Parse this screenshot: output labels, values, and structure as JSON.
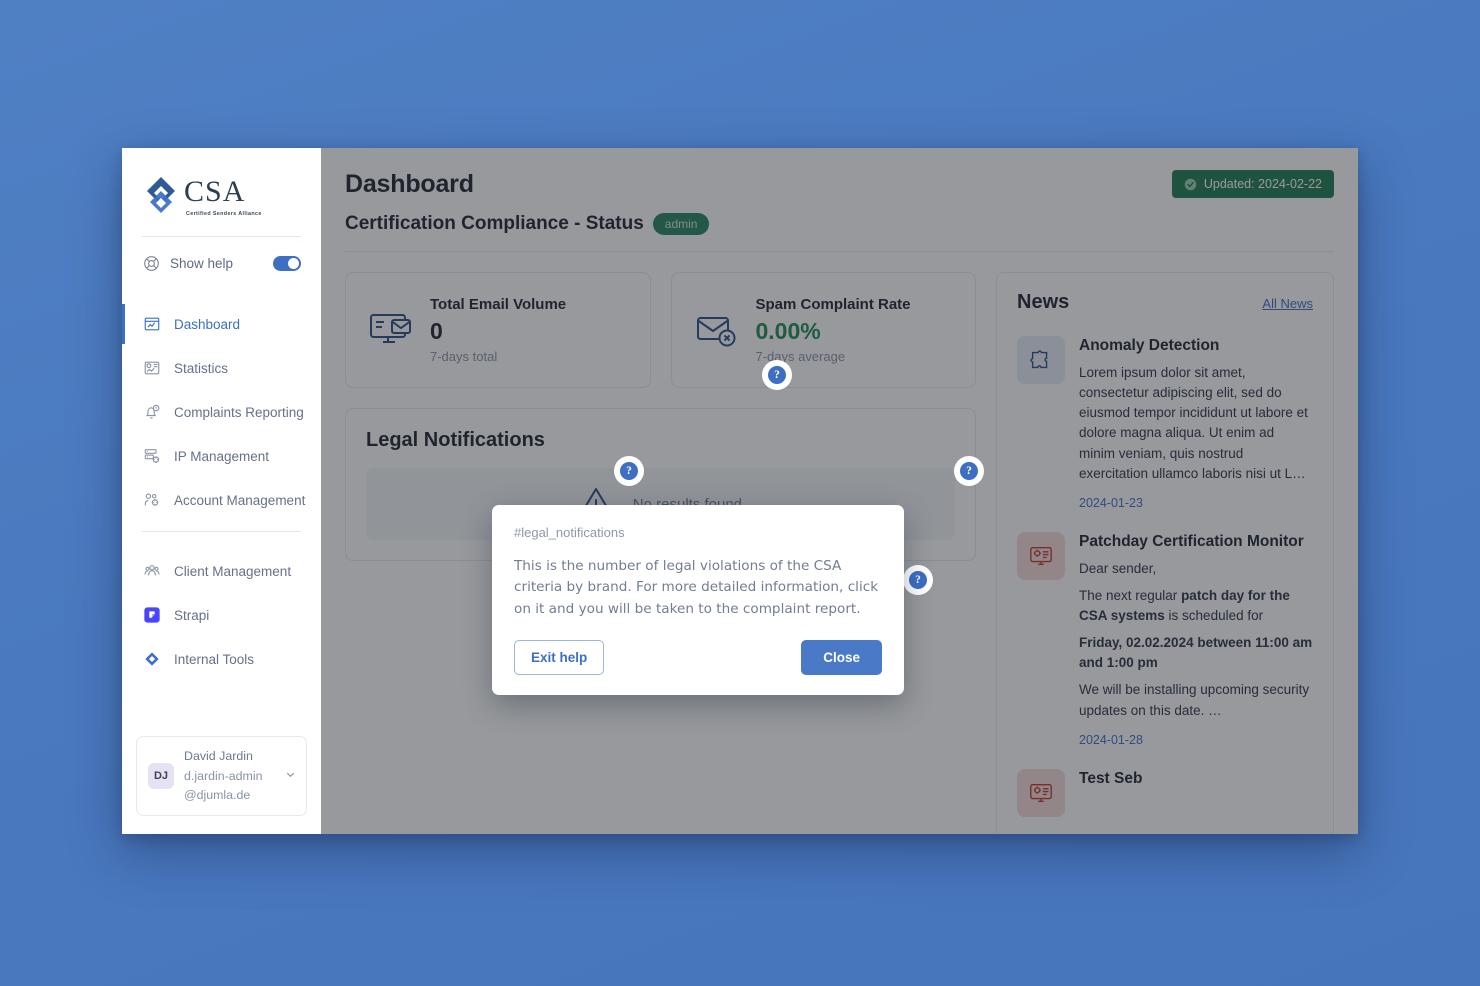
{
  "sidebar": {
    "logo": {
      "name": "CSA",
      "tagline": "Certified Senders Alliance"
    },
    "show_help": {
      "label": "Show help",
      "enabled": true,
      "icon": "lifebuoy-icon"
    },
    "items": [
      {
        "label": "Dashboard",
        "icon": "dashboard-icon",
        "active": true
      },
      {
        "label": "Statistics",
        "icon": "statistics-icon",
        "active": false
      },
      {
        "label": "Complaints Reporting",
        "icon": "bell-alert-icon",
        "active": false
      },
      {
        "label": "IP Management",
        "icon": "server-gear-icon",
        "active": false
      },
      {
        "label": "Account Management",
        "icon": "users-gear-icon",
        "active": false
      }
    ],
    "items_secondary": [
      {
        "label": "Client Management",
        "icon": "people-group-icon",
        "active": false
      },
      {
        "label": "Strapi",
        "icon": "strapi-icon",
        "active": false
      },
      {
        "label": "Internal Tools",
        "icon": "diamond-icon",
        "active": false
      }
    ],
    "user": {
      "initials": "DJ",
      "name": "David Jardin",
      "email": "d.jardin-admin@djumla.de",
      "chevron": "chevron-down-icon"
    }
  },
  "header": {
    "title": "Dashboard",
    "subtitle": "Certification Compliance - Status",
    "role_badge": "admin",
    "updated_badge": {
      "label": "Updated: 2024-02-22",
      "icon": "check-circle-icon",
      "color": "#1f7a52"
    }
  },
  "stats": [
    {
      "title": "Total Email Volume",
      "value": "0",
      "sub": "7-days total",
      "icon": "monitor-mail-icon",
      "value_color": "#1d2330"
    },
    {
      "title": "Spam Complaint Rate",
      "value": "0.00%",
      "sub": "7-days average",
      "icon": "mail-x-icon",
      "value_color": "#1f8a55"
    }
  ],
  "notifications": {
    "title": "Legal Notifications",
    "empty_text": "No results found.",
    "empty_icon": "warning-triangle-icon"
  },
  "news": {
    "title": "News",
    "all_link": "All News",
    "items": [
      {
        "heading": "Anomaly Detection",
        "body": "Lorem ipsum dolor sit amet, consectetur adipiscing elit, sed do eiusmod tempor incididunt ut labore et dolore magna aliqua. Ut enim ad minim veniam, quis nostrud exercitation ullamco laboris nisi ut L…",
        "date": "2024-01-23",
        "icon": "puzzle-icon",
        "icon_tone": "blue"
      },
      {
        "heading": "Patchday Certification Monitor",
        "line1": "Dear sender,",
        "line2_pre": "The next regular ",
        "line2_bold": "patch day for the CSA systems",
        "line2_post": " is scheduled for",
        "line3_bold": "Friday, 02.02.2024 between 11:00 am and 1:00 pm",
        "line4": "We will be installing upcoming security updates on this date. …",
        "date": "2024-01-28",
        "icon": "monitor-gear-icon",
        "icon_tone": "red"
      },
      {
        "heading": "Test Seb",
        "icon": "monitor-gear-icon",
        "icon_tone": "red"
      }
    ]
  },
  "help_badges": {
    "glyph": "?",
    "names": [
      "subtitle-help",
      "total-email-volume-help",
      "spam-rate-help",
      "legal-notifications-help"
    ]
  },
  "modal": {
    "tag": "#legal_notifications",
    "text": "This is the number of legal violations of the CSA criteria by brand. For more detailed information, click on it and you will be taken to the complaint report.",
    "exit_label": "Exit help",
    "close_label": "Close",
    "primary_color": "#4a79c7"
  },
  "colors": {
    "desktop_bg": "#4b7bc0",
    "accent_blue": "#3d6fc4",
    "green": "#1f7a52",
    "overlay": "rgba(35,38,44,0.47)"
  }
}
